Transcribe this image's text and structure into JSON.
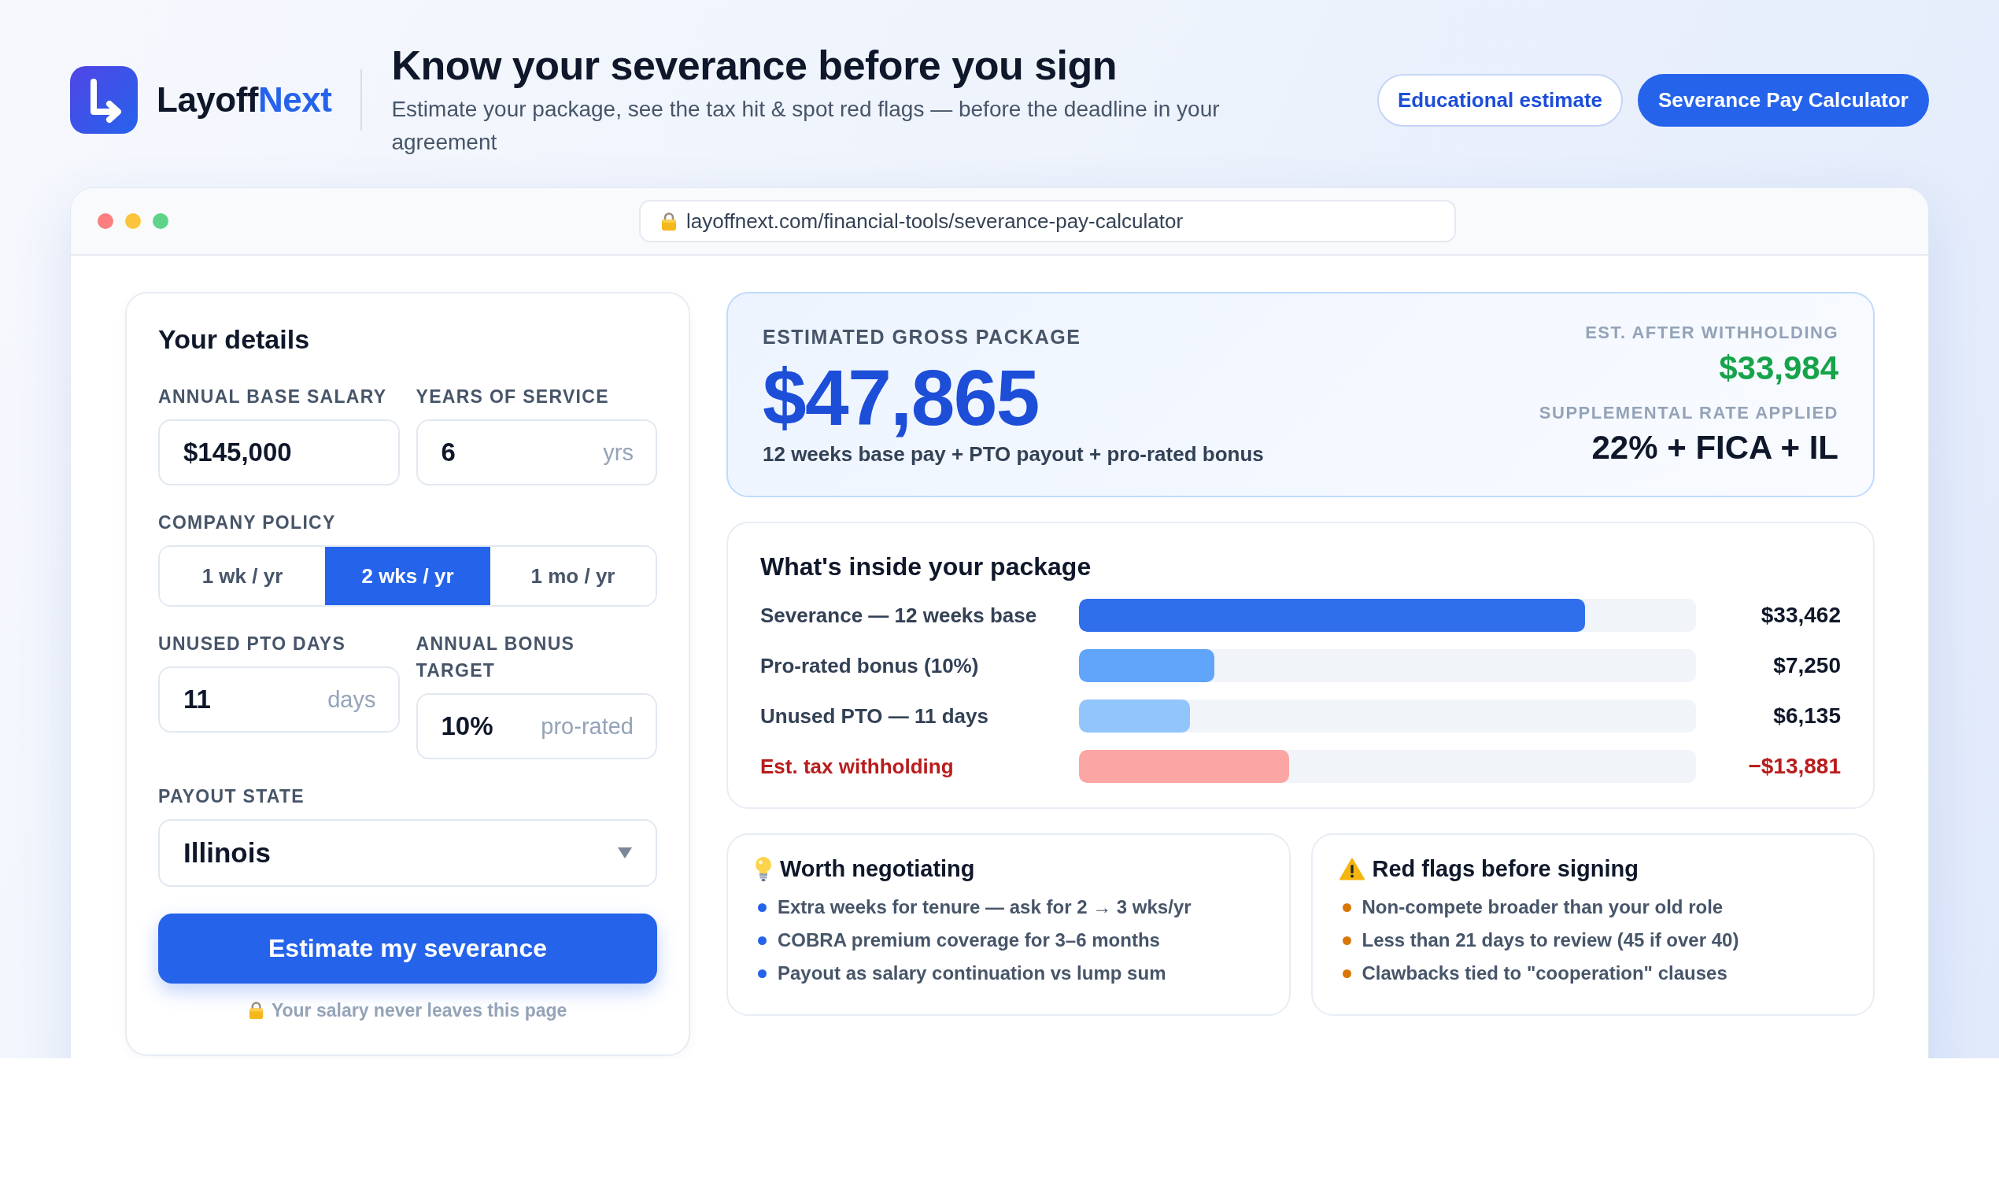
{
  "brand": {
    "name": "Layoff",
    "accent": "Next"
  },
  "header": {
    "title": "Know your severance before you sign",
    "subtitle": "Estimate your package, see the tax hit & spot red flags — before the deadline in your agreement"
  },
  "header_buttons": [
    {
      "label": "Educational estimate",
      "kind": "outline"
    },
    {
      "label": "Severance Pay Calculator",
      "kind": "solid"
    }
  ],
  "browser": {
    "url": "layoffnext.com/financial-tools/severance-pay-calculator"
  },
  "details": {
    "title": "Your details",
    "fields": [
      {
        "kind": "text",
        "label": "ANNUAL BASE SALARY",
        "value": "$145,000"
      },
      {
        "kind": "text",
        "label": "YEARS OF SERVICE",
        "value": "6",
        "suffix": "yrs"
      },
      {
        "kind": "segmented",
        "label": "COMPANY POLICY",
        "options": [
          {
            "label": "1 wk / yr",
            "selected": false
          },
          {
            "label": "2 wks / yr",
            "selected": true
          },
          {
            "label": "1 mo / yr",
            "selected": false
          }
        ]
      },
      {
        "kind": "text",
        "label": "UNUSED PTO DAYS",
        "value": "11",
        "suffix": "days"
      },
      {
        "kind": "text",
        "label": "ANNUAL BONUS TARGET",
        "value": "10%",
        "suffix": "pro-rated"
      },
      {
        "kind": "select",
        "label": "PAYOUT STATE",
        "value": "Illinois"
      }
    ],
    "submit": "Estimate my severance",
    "privacy_note": "Your salary never leaves this page"
  },
  "summary": {
    "label": "ESTIMATED GROSS PACKAGE",
    "amount": "$47,865",
    "note": "12 weeks base pay + PTO payout + pro-rated bonus",
    "after_label": "EST. AFTER WITHHOLDING",
    "after_amount": "$33,984",
    "rate_label": "SUPPLEMENTAL RATE APPLIED",
    "rate": "22% + FICA + IL"
  },
  "breakdown": {
    "title": "What's inside your package",
    "rows": [
      {
        "kind": "earning",
        "label": "Severance — 12 weeks base",
        "amount": "$33,462",
        "level": 0.82,
        "color": "#2f6fec"
      },
      {
        "kind": "earning",
        "label": "Pro-rated bonus (10%)",
        "amount": "$7,250",
        "level": 0.22,
        "color": "#60a5fa"
      },
      {
        "kind": "earning",
        "label": "Unused PTO — 11 days",
        "amount": "$6,135",
        "level": 0.18,
        "color": "#93c5fd"
      },
      {
        "kind": "deduction",
        "label": "Est. tax withholding",
        "amount": "−$13,881",
        "level": 0.34,
        "color": "#fca5a5"
      }
    ]
  },
  "cards": [
    {
      "kind": "tip",
      "title": "Worth negotiating",
      "items": [
        "Extra weeks for tenure — ask for 2 → 3 wks/yr",
        "COBRA premium coverage for 3–6 months",
        "Payout as salary continuation vs lump sum"
      ]
    },
    {
      "kind": "warning",
      "title": "Red flags before signing",
      "items": [
        "Non-compete broader than your old role",
        "Less than 21 days to review (45 if over 40)",
        "Clawbacks tied to \"cooperation\" clauses"
      ]
    }
  ]
}
